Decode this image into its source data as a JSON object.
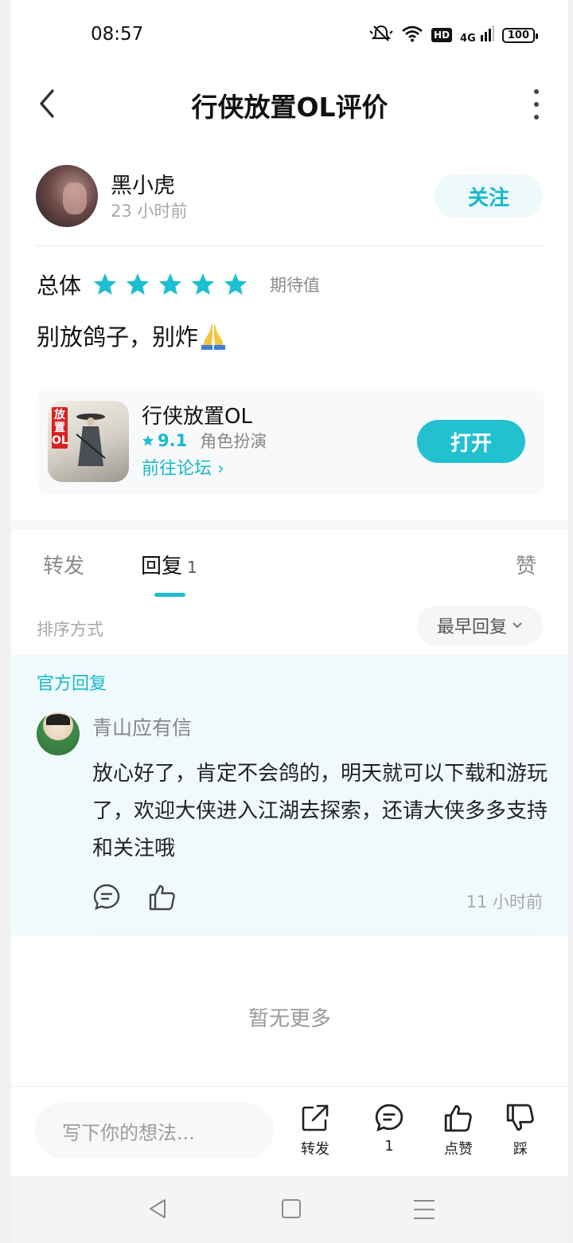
{
  "status_bar": {
    "time": "08:57",
    "icons": [
      "mute-icon",
      "wifi-icon",
      "hd-icon",
      "signal-4g-icon",
      "battery-icon"
    ],
    "hd": "HD",
    "network": "4G",
    "battery": "100"
  },
  "header": {
    "title": "行侠放置OL评价"
  },
  "author": {
    "name": "黑小虎",
    "time": "23 小时前",
    "follow_label": "关注"
  },
  "rating": {
    "label": "总体",
    "stars": 5,
    "extra": "期待值"
  },
  "review": {
    "text": "别放鸽子，别炸"
  },
  "app_card": {
    "name": "行侠放置OL",
    "score": "9.1",
    "genre": "角色扮演",
    "forum_link": "前往论坛 ›",
    "open_label": "打开",
    "icon_tag": "放置OL"
  },
  "tabs": {
    "forward": "转发",
    "reply": "回复",
    "reply_count": "1",
    "like": "赞"
  },
  "sort": {
    "label": "排序方式",
    "selected": "最早回复"
  },
  "official_reply": {
    "section_label": "官方回复",
    "name": "青山应有信",
    "body": "放心好了，肯定不会鸽的，明天就可以下载和游玩了，欢迎大侠进入江湖去探索，还请大侠多多支持和关注哦",
    "time": "11 小时前"
  },
  "footer_note": "暂无更多",
  "bottom_bar": {
    "input_placeholder": "写下你的想法...",
    "forward_label": "转发",
    "comment_count": "1",
    "like_label": "点赞",
    "dislike_label": "踩"
  },
  "colors": {
    "accent": "#1cbfcf",
    "star": "#1cbfcf",
    "official_bg": "#f0fafd"
  }
}
